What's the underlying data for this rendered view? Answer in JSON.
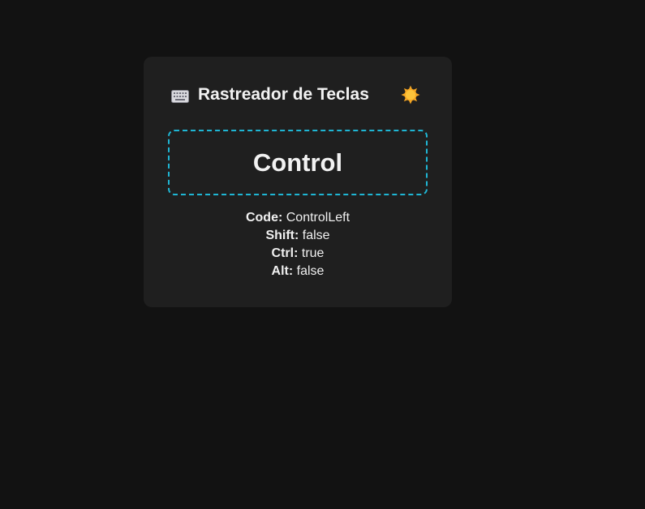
{
  "app": {
    "title": "Rastreador de Teclas",
    "icons": {
      "title_icon": "keyboard-icon",
      "theme_toggle_icon": "sun-icon"
    }
  },
  "key_display": {
    "key": "Control"
  },
  "details": [
    {
      "label": "Code:",
      "value": "ControlLeft"
    },
    {
      "label": "Shift:",
      "value": "false"
    },
    {
      "label": "Ctrl:",
      "value": "true"
    },
    {
      "label": "Alt:",
      "value": "false"
    }
  ],
  "colors": {
    "page_background": "#121212",
    "card_background": "#1f1f1f",
    "accent_border": "#1fb6d4",
    "text": "#f2f2f2",
    "sun": "#f5a623"
  }
}
